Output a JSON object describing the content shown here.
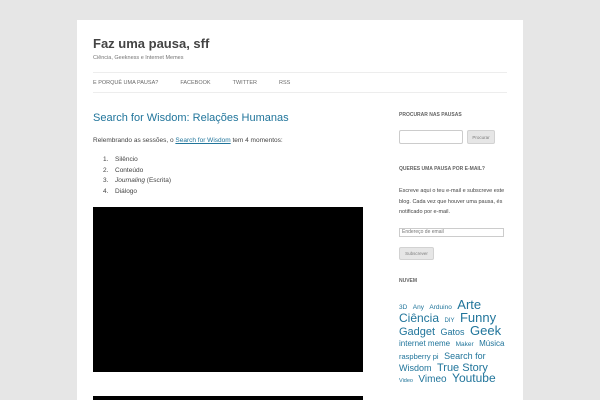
{
  "site": {
    "title": "Faz uma pausa, sff",
    "description": "Ciência, Geekness e Internet Memes"
  },
  "nav": [
    "E PORQUÊ UMA PAUSA?",
    "FACEBOOK",
    "TWITTER",
    "RSS"
  ],
  "post": {
    "title": "Search for Wisdom: Relações Humanas",
    "intro_before": "Relembrando as sessões, o ",
    "intro_link": "Search for Wisdom",
    "intro_after": " tem 4 momentos:",
    "list": [
      {
        "num": "1.",
        "text": "Silêncio"
      },
      {
        "num": "2.",
        "text": "Conteúdo"
      },
      {
        "num": "3.",
        "text": "Journaling",
        "suffix": " (Escrita)"
      },
      {
        "num": "4.",
        "text": "Diálogo"
      }
    ]
  },
  "sidebar": {
    "search_title": "PROCURAR NAS PAUSAS",
    "search_button": "Procurar",
    "email_title": "QUERES UMA PAUSA POR E-MAIL?",
    "email_text": "Escreve aqui o teu e-mail e subscreve este blog. Cada vez que houver uma pausa, és notificado por e-mail.",
    "email_placeholder": "Endereço de email",
    "subscribe_button": "Subscrever",
    "cloud_title": "NUVEM",
    "tags": [
      {
        "label": "3D",
        "size": 6.5
      },
      {
        "label": "Any",
        "size": 6.5
      },
      {
        "label": "Arduino",
        "size": 6.5
      },
      {
        "label": "Arte",
        "size": 13
      },
      {
        "label": "Ciência",
        "size": 12
      },
      {
        "label": "DIY",
        "size": 6
      },
      {
        "label": "Funny",
        "size": 13
      },
      {
        "label": "Gadget",
        "size": 11
      },
      {
        "label": "Gatos",
        "size": 9
      },
      {
        "label": "Geek",
        "size": 13
      },
      {
        "label": "internet meme",
        "size": 8
      },
      {
        "label": "Maker",
        "size": 6.5
      },
      {
        "label": "Música",
        "size": 8
      },
      {
        "label": "raspberry pi",
        "size": 7.5
      },
      {
        "label": "Search for Wisdom",
        "size": 9
      },
      {
        "label": "True Story",
        "size": 11
      },
      {
        "label": "Video",
        "size": 5.5
      },
      {
        "label": "Vimeo",
        "size": 10
      },
      {
        "label": "Youtube",
        "size": 12
      }
    ]
  }
}
